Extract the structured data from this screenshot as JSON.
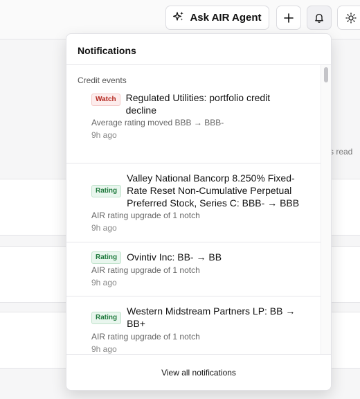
{
  "topbar": {
    "agent_button": "Ask AIR Agent",
    "icons": [
      "sparkles-icon",
      "plus-icon",
      "bell-icon",
      "sun-icon"
    ]
  },
  "background": {
    "fragment_text": "s read"
  },
  "notifications": {
    "title": "Notifications",
    "section_label": "Credit events",
    "items": [
      {
        "badge": "Watch",
        "badge_type": "watch",
        "title": "Regulated Utilities: portfolio credit decline",
        "description": "Average rating moved BBB → BBB-",
        "time": "9h ago"
      },
      {
        "badge": "Rating",
        "badge_type": "rating",
        "title": "Valley National Bancorp 8.250% Fixed-Rate Reset Non-Cumulative Perpetual Preferred Stock, Series C: BBB- → BBB",
        "description": "AIR rating upgrade of 1 notch",
        "time": "9h ago"
      },
      {
        "badge": "Rating",
        "badge_type": "rating",
        "title": "Ovintiv Inc: BB- → BB",
        "description": "AIR rating upgrade of 1 notch",
        "time": "9h ago"
      },
      {
        "badge": "Rating",
        "badge_type": "rating",
        "title": "Western Midstream Partners LP: BB → BB+",
        "description": "AIR rating upgrade of 1 notch",
        "time": "9h ago"
      }
    ],
    "footer_link": "View all notifications"
  },
  "colors": {
    "watch": "#b3261e",
    "rating": "#1f7a3d",
    "border": "#e2e2e6"
  }
}
